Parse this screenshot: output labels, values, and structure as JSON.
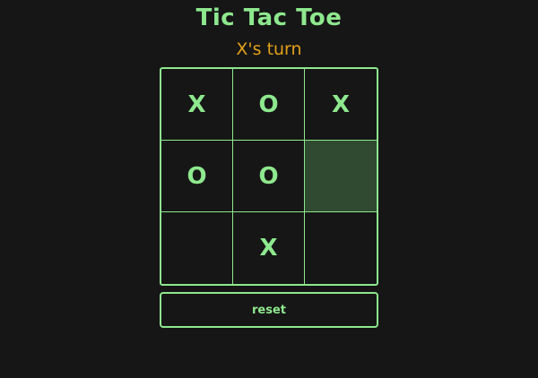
{
  "game": {
    "title": "Tic Tac Toe",
    "status": "X's turn",
    "reset_label": "reset",
    "colors": {
      "background": "#161616",
      "accent": "#8ee88e",
      "status": "#e3a11a",
      "hover_cell": "#2f4a30"
    },
    "board": [
      [
        "X",
        "O",
        "X"
      ],
      [
        "O",
        "O",
        ""
      ],
      [
        "",
        "X",
        ""
      ]
    ],
    "hovered_cell": [
      1,
      2
    ]
  }
}
